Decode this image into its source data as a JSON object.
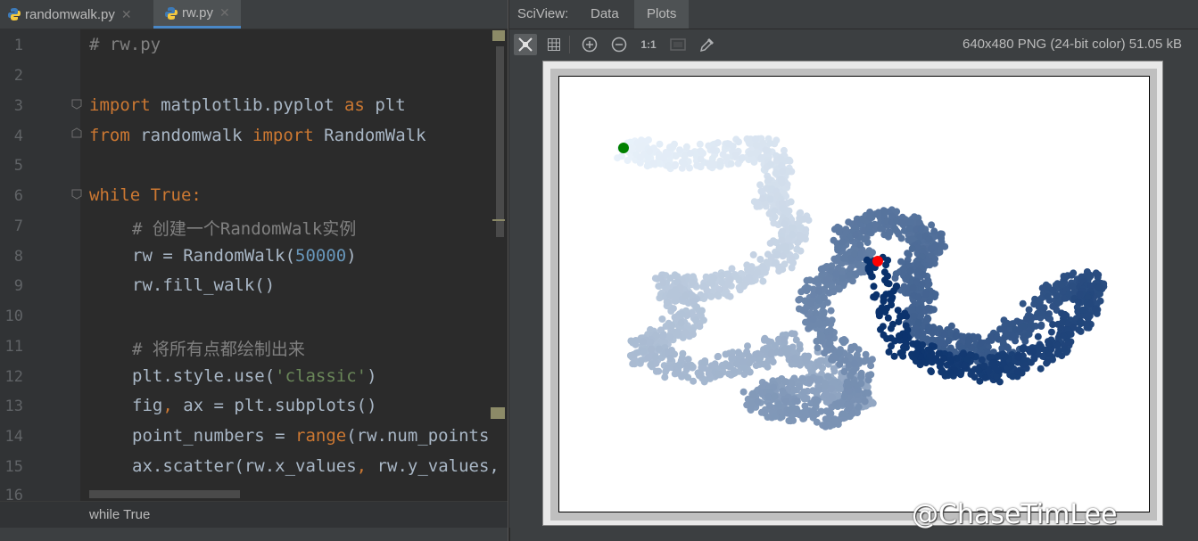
{
  "editor": {
    "tabs": [
      {
        "label": "randomwalk.py",
        "icon": "python-file-icon"
      },
      {
        "label": "rw.py",
        "icon": "python-file-icon"
      }
    ],
    "line_numbers": [
      "1",
      "2",
      "3",
      "4",
      "5",
      "6",
      "7",
      "8",
      "9",
      "10",
      "11",
      "12",
      "13",
      "14",
      "15",
      "16"
    ],
    "lines": {
      "l1": "# rw.py",
      "l3_kw1": "import",
      "l3_mod": " matplotlib.pyplot ",
      "l3_kw2": "as",
      "l3_alias": " plt",
      "l4_kw1": "from",
      "l4_mod": " randomwalk ",
      "l4_kw2": "import",
      "l4_name": " RandomWalk",
      "l6_kw1": "while",
      "l6_kw2": " True",
      "l6_colon": ":",
      "l7": "# 创建一个RandomWalk实例",
      "l8_a": "rw = RandomWalk(",
      "l8_num": "50000",
      "l8_b": ")",
      "l9": "rw.fill_walk()",
      "l11": "# 将所有点都绘制出来",
      "l12_a": "plt.style.use(",
      "l12_str": "'classic'",
      "l12_b": ")",
      "l13_a": "fig",
      "l13_comma": ",",
      "l13_b": " ax = plt.subplots()",
      "l14_a": "point_numbers = ",
      "l14_kw": "range",
      "l14_b": "(rw.num_points",
      "l15_a": "ax.scatter(rw.x_values",
      "l15_comma": ",",
      "l15_b": " rw.y_values,"
    },
    "breadcrumb": "while True"
  },
  "sciview": {
    "title": "SciView:",
    "tabs": [
      "Data",
      "Plots"
    ],
    "active_tab": "Plots",
    "image_info": "640x480 PNG (24-bit color) 51.05 kB",
    "tools": [
      "fit-icon",
      "grid-icon",
      "zoom-in-icon",
      "zoom-out-icon",
      "actual-size-icon",
      "background-icon",
      "color-picker-icon"
    ],
    "actual_size_label": "1:1"
  },
  "watermark": "@ChaseTimLee",
  "chart_data": {
    "type": "scatter",
    "colormap": "Blues",
    "num_points": 50000,
    "start_point_color": "#008000",
    "end_point_color": "#ff0000",
    "axes_visible": false
  }
}
